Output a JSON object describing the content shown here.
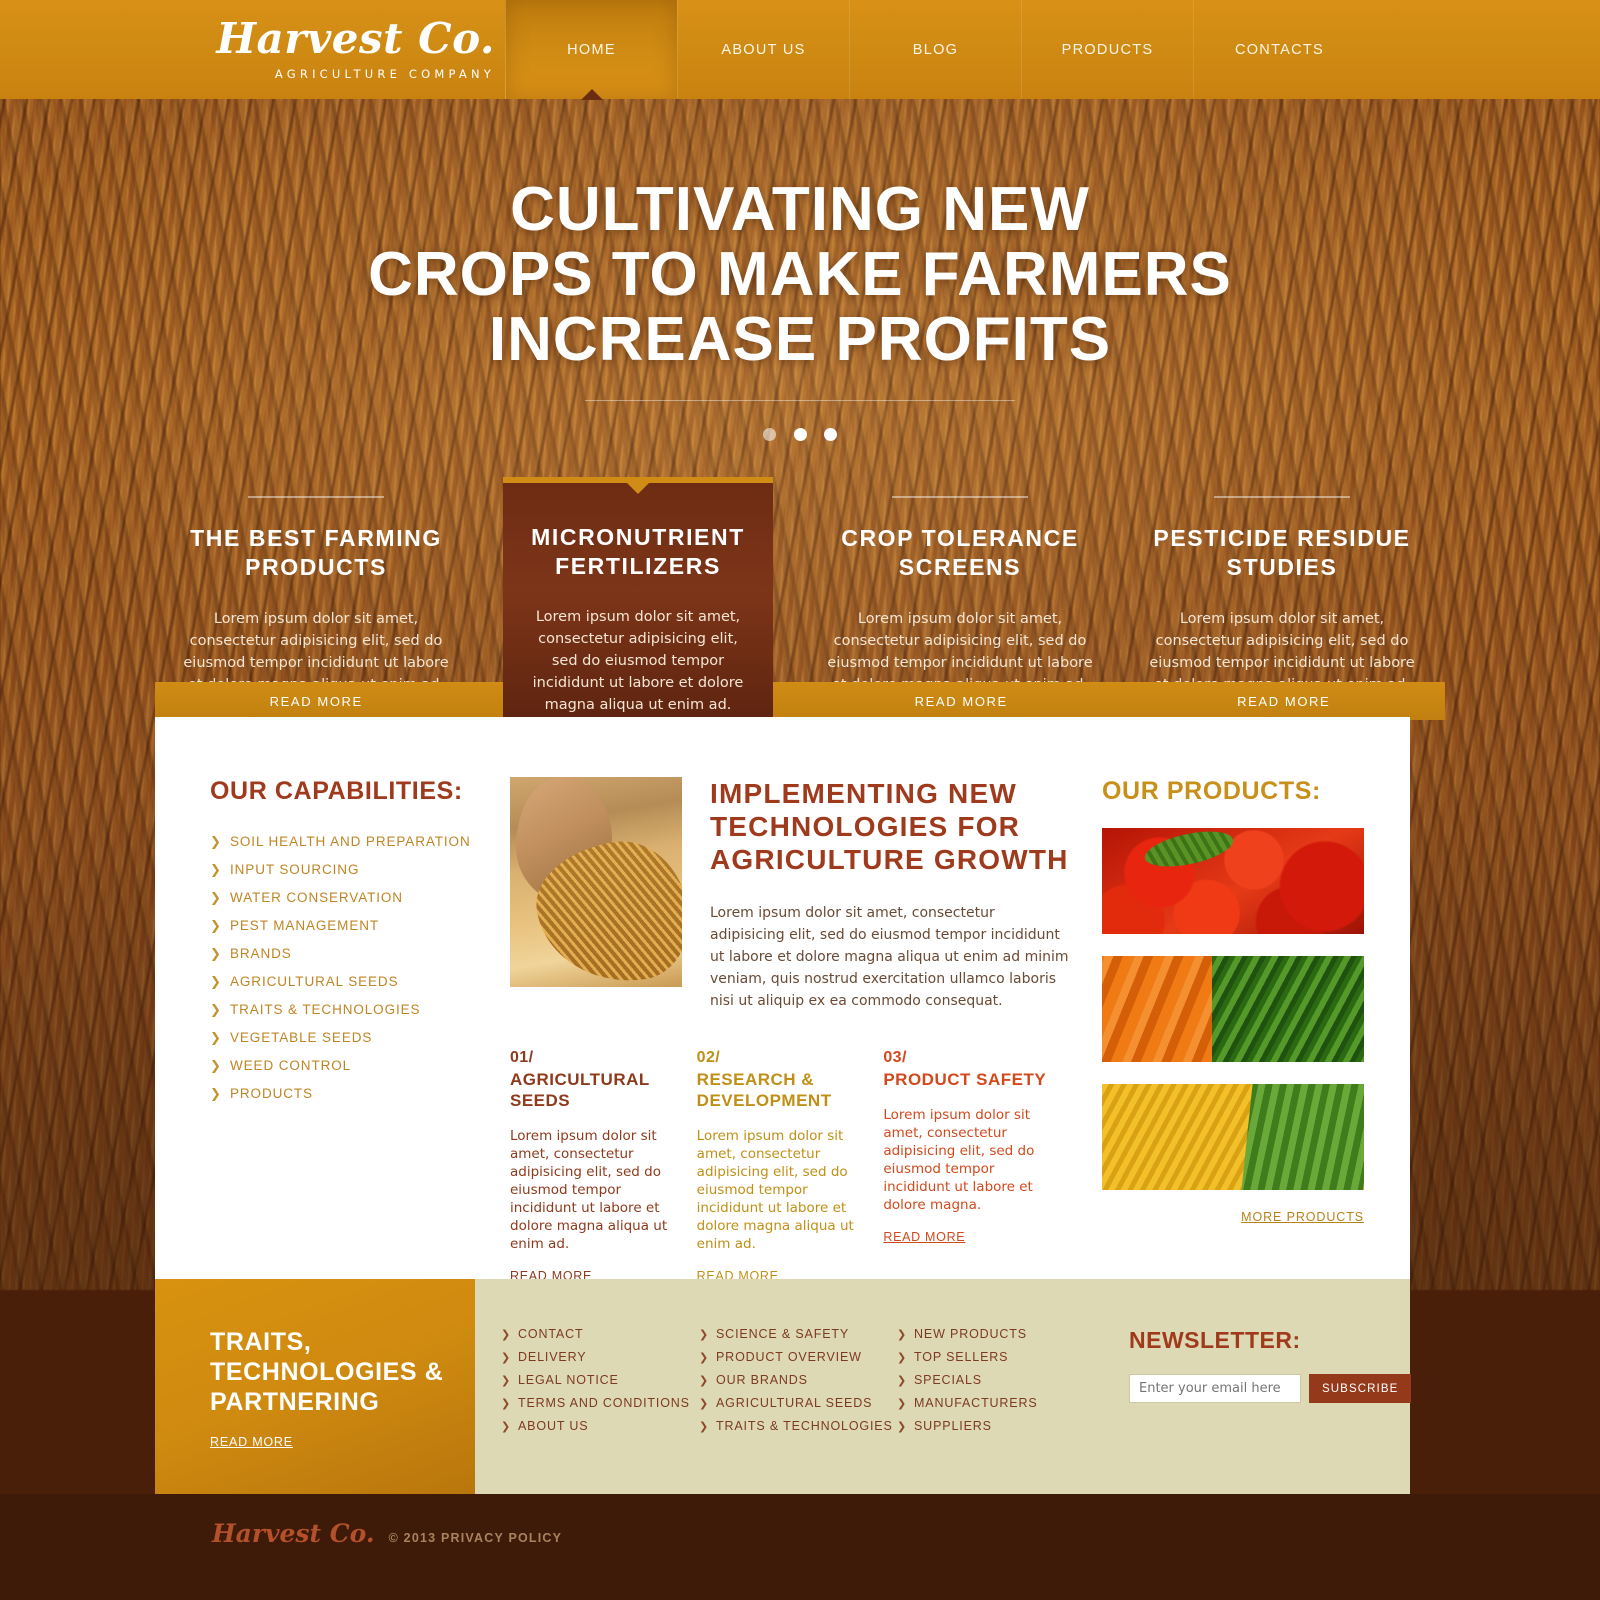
{
  "header": {
    "logo_name": "Harvest Co.",
    "logo_tagline": "AGRICULTURE COMPANY",
    "nav": [
      {
        "label": "HOME",
        "active": true
      },
      {
        "label": "ABOUT US",
        "active": false
      },
      {
        "label": "BLOG",
        "active": false
      },
      {
        "label": "PRODUCTS",
        "active": false
      },
      {
        "label": "CONTACTS",
        "active": false
      }
    ]
  },
  "hero": {
    "line1": "CULTIVATING NEW",
    "line2": "CROPS TO MAKE FARMERS",
    "line3": "INCREASE PROFITS",
    "slide_count": 3,
    "active_slide": 1
  },
  "features": {
    "read_more": "READ MORE",
    "body": "Lorem ipsum dolor sit amet, consectetur adipisicing elit, sed do eiusmod tempor incididunt ut labore et dolore magna aliqua ut enim ad.",
    "items": [
      {
        "title": "THE BEST FARMING PRODUCTS"
      },
      {
        "title": "MICRONUTRIENT FERTILIZERS"
      },
      {
        "title": "CROP TOLERANCE SCREENS"
      },
      {
        "title": "PESTICIDE RESIDUE STUDIES"
      }
    ],
    "highlight_index": 1
  },
  "capabilities": {
    "title": "OUR CAPABILITIES:",
    "items": [
      "SOIL HEALTH AND PREPARATION",
      "INPUT SOURCING",
      "WATER CONSERVATION",
      "PEST MANAGEMENT",
      "BRANDS",
      "AGRICULTURAL SEEDS",
      "TRAITS & TECHNOLOGIES",
      "VEGETABLE SEEDS",
      "WEED CONTROL",
      "PRODUCTS"
    ]
  },
  "main": {
    "heading": "IMPLEMENTING NEW TECHNOLOGIES FOR AGRICULTURE GROWTH",
    "body": "Lorem ipsum dolor sit amet, consectetur adipisicing elit, sed do eiusmod tempor incididunt ut labore et dolore magna aliqua ut enim ad minim veniam, quis nostrud exercitation ullamco laboris nisi ut aliquip ex ea commodo consequat.",
    "photo_alt": "farmer-smelling-wheat-photo",
    "columns": [
      {
        "num": "01/",
        "title": "AGRICULTURAL SEEDS",
        "body": "Lorem ipsum dolor sit amet, consectetur adipisicing elit, sed do eiusmod tempor incididunt ut labore et dolore magna aliqua ut enim ad.",
        "read_more": "READ MORE",
        "color": "#8e3a1c"
      },
      {
        "num": "02/",
        "title": "RESEARCH & DEVELOPMENT",
        "body": "Lorem ipsum dolor sit amet, consectetur adipisicing elit, sed do eiusmod tempor incididunt ut labore et dolore magna aliqua ut enim ad.",
        "read_more": "READ MORE",
        "color": "#c08f16"
      },
      {
        "num": "03/",
        "title": "PRODUCT SAFETY",
        "body": "Lorem ipsum dolor sit amet, consectetur adipisicing elit, sed do eiusmod tempor incididunt ut labore et dolore magna.",
        "read_more": "READ MORE",
        "color": "#d2491c"
      }
    ]
  },
  "products": {
    "title": "OUR PRODUCTS:",
    "thumbs": [
      "tomatoes-photo",
      "carrots-photo",
      "corn-photo"
    ],
    "more_label": "MORE PRODUCTS"
  },
  "footer": {
    "promo_title": "TRAITS, TECHNOLOGIES & PARTNERING",
    "promo_read_more": "READ MORE",
    "columns": [
      [
        "CONTACT",
        "DELIVERY",
        "LEGAL NOTICE",
        "TERMS AND CONDITIONS",
        "ABOUT US"
      ],
      [
        "SCIENCE & SAFETY",
        "PRODUCT OVERVIEW",
        "OUR BRANDS",
        "AGRICULTURAL SEEDS",
        "TRAITS & TECHNOLOGIES"
      ],
      [
        "NEW PRODUCTS",
        "TOP SELLERS",
        "SPECIALS",
        "MANUFACTURERS",
        "SUPPLIERS"
      ]
    ],
    "newsletter": {
      "title": "NEWSLETTER:",
      "placeholder": "Enter your email here",
      "value": "",
      "button": "SUBSCRIBE"
    }
  },
  "copyright": {
    "logo": "Harvest Co.",
    "text": "© 2013 PRIVACY POLICY"
  },
  "colors": {
    "brand_gold": "#d08c14",
    "brand_brown": "#6e2c14",
    "accent_red": "#a03a1c",
    "footer_beige": "#ddd9b4",
    "dark_bar": "#3e1a08"
  }
}
